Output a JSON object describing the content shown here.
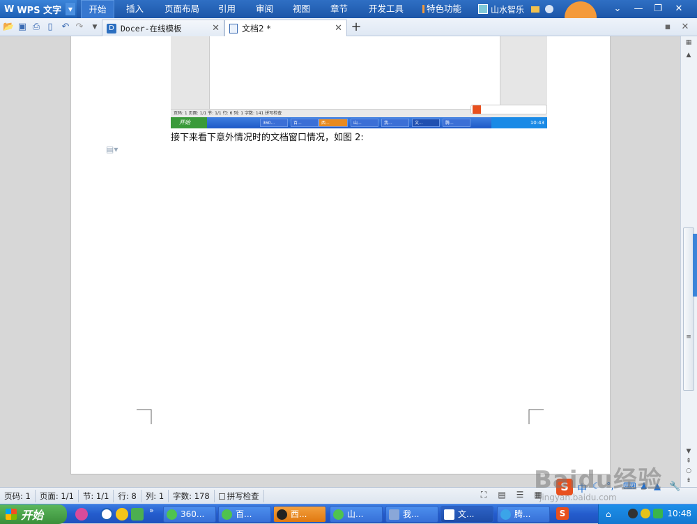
{
  "app": {
    "name": "WPS 文字",
    "logo_glyph": "W"
  },
  "ribbon": {
    "tabs": [
      {
        "label": "开始",
        "active": true
      },
      {
        "label": "插入"
      },
      {
        "label": "页面布局"
      },
      {
        "label": "引用"
      },
      {
        "label": "审阅"
      },
      {
        "label": "视图"
      },
      {
        "label": "章节"
      },
      {
        "label": "开发工具"
      },
      {
        "label": "特色功能"
      }
    ],
    "user_name": "山水智乐"
  },
  "tabs": {
    "docer": {
      "label": "Docer-在线模板"
    },
    "doc2": {
      "label": "文档2 *"
    }
  },
  "document": {
    "paragraph": "接下来看下意外情况时的文档窗口情况，如图 2:"
  },
  "embedded_screenshot": {
    "status": "页码: 1  页面: 1/1  节: 1/1  行: 6  列: 1  字数: 141  拼写检查",
    "start_label": "开始",
    "taskbar_items": [
      "360...",
      "百...",
      "西...",
      "山...",
      "我...",
      "文...",
      "腾..."
    ],
    "clock": "10:43"
  },
  "statusbar": {
    "page": "页码: 1",
    "pages": "页面: 1/1",
    "section": "节: 1/1",
    "row": "行: 8",
    "col": "列: 1",
    "words": "字数: 178",
    "spell": "拼写检查"
  },
  "taskbar": {
    "start_label": "开始",
    "items": [
      {
        "label": "360..."
      },
      {
        "label": "百..."
      },
      {
        "label": "西..."
      },
      {
        "label": "山..."
      },
      {
        "label": "我..."
      },
      {
        "label": "文..."
      },
      {
        "label": "腾..."
      }
    ],
    "clock": "10:48"
  },
  "watermark": {
    "logo": "Baidu经验",
    "url": "jingyan.baidu.com"
  },
  "colors": {
    "ribbon": "#1c56a8",
    "taskbar": "#245ccd",
    "start": "#3a8f3a",
    "accent_orange": "#f49a3a"
  }
}
